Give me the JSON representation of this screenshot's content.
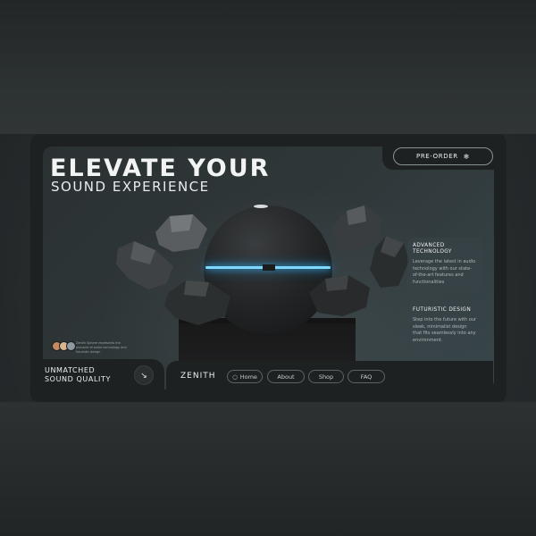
{
  "hero": {
    "title": "ELEVATE YOUR",
    "subtitle": "SOUND EXPERIENCE"
  },
  "cta": {
    "preorder_label": "PRE-ORDER",
    "preorder_icon": "snowflake-icon"
  },
  "features": [
    {
      "title": "ADVANCED TECHNOLOGY",
      "text": "Leverage the latest in audio technology with our state-of-the-art features and functionalities"
    },
    {
      "title": "FUTURISTIC DESIGN",
      "text": "Step into the future with our sleek, minimalist design that fits seamlessly into any environment."
    }
  ],
  "community": {
    "caption": "Zenith Sphere represents the pinnacle of audio technology and futuristic design"
  },
  "tagline": {
    "line1": "UNMATCHED",
    "line2": "SOUND QUALITY",
    "arrow": "↘"
  },
  "nav": {
    "brand": "ZENITH",
    "items": [
      "Home",
      "About",
      "Shop",
      "FAQ"
    ],
    "active_indicator": "○"
  },
  "colors": {
    "accent_glow": "#39b8ff",
    "card_bg": "#1e2122",
    "text_primary": "#f2f4f4"
  }
}
